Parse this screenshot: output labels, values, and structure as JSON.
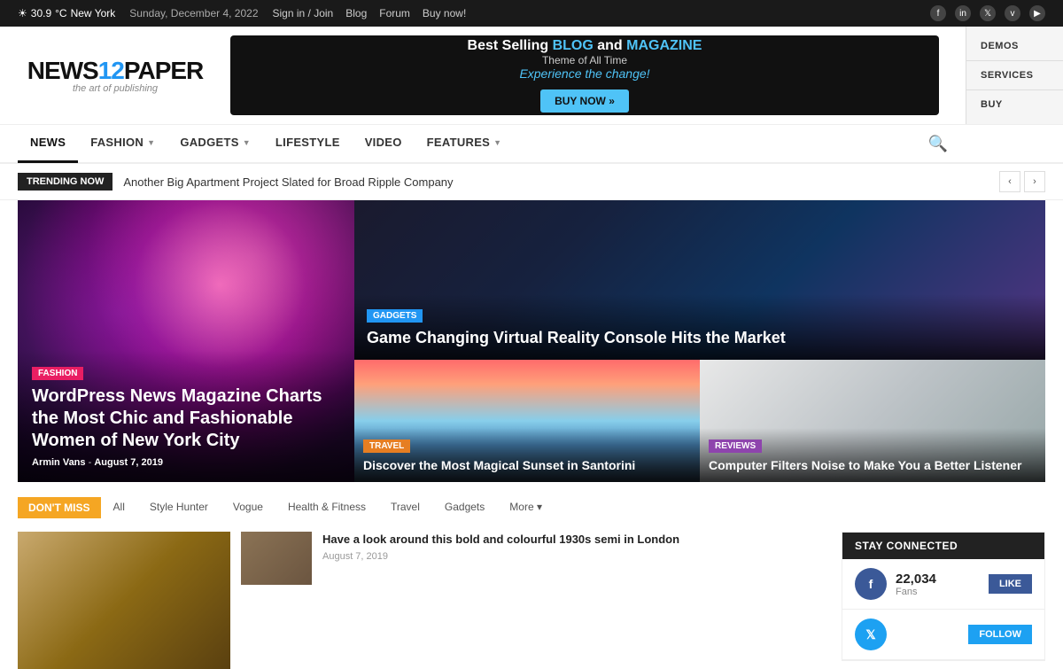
{
  "topbar": {
    "weather_icon": "☀",
    "temperature": "30.9",
    "temp_unit": "°C",
    "city": "New York",
    "date": "Sunday, December 4, 2022",
    "links": [
      "Sign in / Join",
      "Blog",
      "Forum",
      "Buy now!"
    ],
    "social": [
      "f",
      "in",
      "tw",
      "v",
      "yt"
    ]
  },
  "logo": {
    "text_1": "NEWS",
    "text_2": "12",
    "text_3": "PAPER",
    "tagline": "the art of publishing"
  },
  "ad": {
    "line1": "Best Selling BLOG and MAGAZINE",
    "line2": "Theme of All Time",
    "line3": "Experience the change!",
    "btn": "BUY NOW »"
  },
  "side_nav": {
    "items": [
      "DEMOS",
      "SERVICES",
      "BUY"
    ]
  },
  "nav": {
    "items": [
      {
        "label": "NEWS",
        "active": true,
        "has_arrow": false
      },
      {
        "label": "FASHION",
        "active": false,
        "has_arrow": true
      },
      {
        "label": "GADGETS",
        "active": false,
        "has_arrow": true
      },
      {
        "label": "LIFESTYLE",
        "active": false,
        "has_arrow": false
      },
      {
        "label": "VIDEO",
        "active": false,
        "has_arrow": false
      },
      {
        "label": "FEATURES",
        "active": false,
        "has_arrow": true
      }
    ]
  },
  "trending": {
    "label": "TRENDING NOW",
    "text": "Another Big Apartment Project Slated for Broad Ripple Company"
  },
  "hero": {
    "main": {
      "category": "FASHION",
      "title": "WordPress News Magazine Charts the Most Chic and Fashionable Women of New York City",
      "author": "Armin Vans",
      "date": "August 7, 2019"
    },
    "top_right": {
      "category": "GADGETS",
      "title": "Game Changing Virtual Reality Console Hits the Market"
    },
    "bottom_left": {
      "category": "TRAVEL",
      "title": "Discover the Most Magical Sunset in Santorini"
    },
    "bottom_right": {
      "category": "REVIEWS",
      "title": "Computer Filters Noise to Make You a Better Listener"
    }
  },
  "dont_miss": {
    "label": "DON'T MISS",
    "tabs": [
      "All",
      "Style Hunter",
      "Vogue",
      "Health & Fitness",
      "Travel",
      "Gadgets",
      "More ▾"
    ]
  },
  "articles": [
    {
      "title": "Have a look around this bold and colourful 1930s semi in London",
      "date": "August 7, 2019"
    }
  ],
  "stay_connected": {
    "title": "STAY CONNECTED",
    "facebook": {
      "count": "22,034",
      "label": "Fans",
      "action": "LIKE"
    },
    "twitter": {
      "count": "",
      "label": "",
      "action": "FOLLOW"
    }
  }
}
